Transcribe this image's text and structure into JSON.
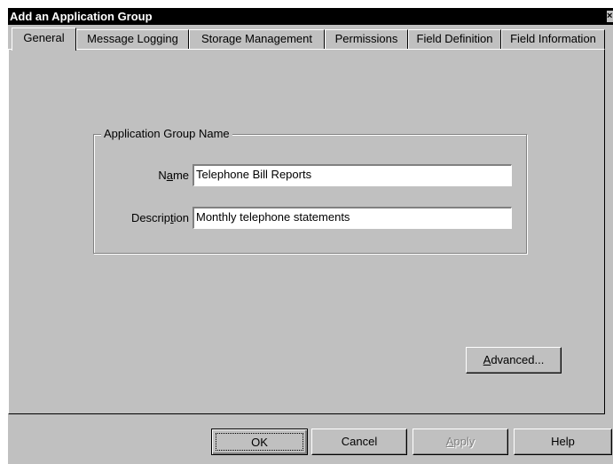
{
  "window": {
    "title": "Add an Application Group",
    "close_glyph": "×"
  },
  "tabs": [
    {
      "label": "General",
      "active": true
    },
    {
      "label": "Message Logging"
    },
    {
      "label": "Storage Management"
    },
    {
      "label": "Permissions"
    },
    {
      "label": "Field Definition"
    },
    {
      "label": "Field Information"
    }
  ],
  "group": {
    "legend": "Application Group Name",
    "name_label": {
      "pre": "N",
      "mnemonic": "a",
      "post": "me"
    },
    "name_value": "Telephone Bill Reports",
    "description_label": {
      "pre": "Descrip",
      "mnemonic": "t",
      "post": "ion"
    },
    "description_value": "Monthly telephone statements"
  },
  "advanced_button": {
    "mnemonic": "A",
    "rest": "dvanced..."
  },
  "footer": {
    "ok": "OK",
    "cancel": "Cancel",
    "apply": {
      "mnemonic": "A",
      "rest": "pply",
      "disabled": true
    },
    "help": "Help"
  }
}
